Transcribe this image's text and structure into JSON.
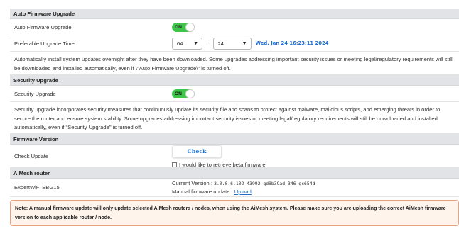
{
  "auto_fw": {
    "header": "Auto Firmware Upgrade",
    "label": "Auto Firmware Upgrade",
    "toggle_label": "ON",
    "time_label": "Preferable Upgrade Time",
    "hour": "04",
    "minute": "24",
    "datetime": "Wed, Jan 24 16:23:11 2024",
    "description": "Automatically install system updates overnight after they have been downloaded. Some upgrades addressing important security issues or meeting legal/regulatory requirements will still be downloaded and installed automatically, even if \\\"Auto Firmware Upgrade\\\" is turned off."
  },
  "security": {
    "header": "Security Upgrade",
    "label": "Security Upgrade",
    "toggle_label": "ON",
    "description": "Security upgrade incorporates security measures that continuously update its security file and scans to protect against malware, malicious scripts, and emerging threats in order to secure the router and ensure system stability. Some upgrades addressing important security issues or meeting legal/regulatory requirements will still be downloaded and installed automatically, even if \"Security Upgrade\" is turned off."
  },
  "firmware": {
    "header": "Firmware Version",
    "check_label": "Check Update",
    "check_button": "Check",
    "beta_label": "I would like to retrieve beta firmware."
  },
  "aimesh": {
    "header": "AiMesh router",
    "device": "ExpertWiFi EBG15",
    "current_version_label": "Current Version : ",
    "current_version": "3.0.0.6.102_43992-gd8b39ad_346-gc654d",
    "manual_label": "Manual firmware update : ",
    "upload": "Upload"
  },
  "note": "Note: A manual firmware update will only update selected AiMesh routers / nodes, when using the AiMesh system. Please make sure you are uploading the correct AiMesh firmware version to each applicable router / node.",
  "colors": {
    "toggle_on": "#3fc64a",
    "link": "#1f6fcb",
    "note_border": "#e9a07f"
  },
  "icons": {
    "select_arrow": "chevron-down-icon"
  }
}
